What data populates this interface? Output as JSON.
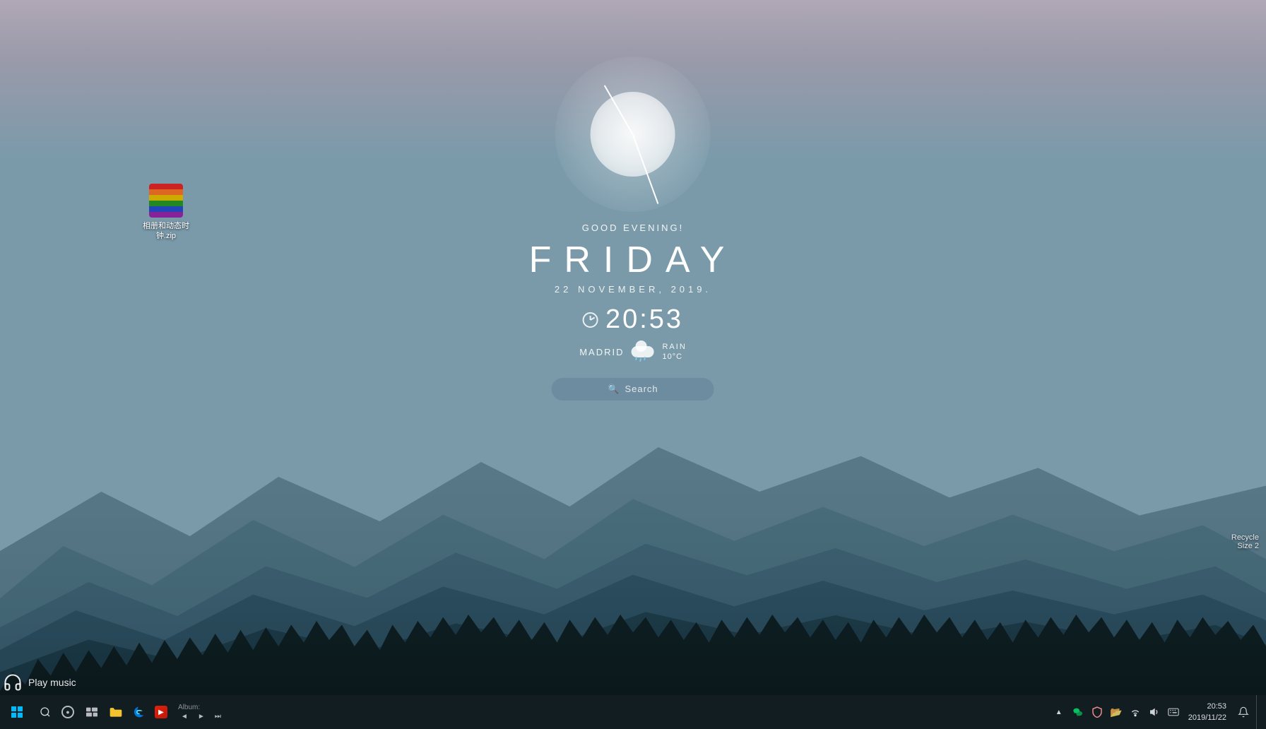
{
  "wallpaper": {
    "description": "Mountain layers wallpaper with teal/blue tones"
  },
  "clock": {
    "greeting": "GOOD EVENING!",
    "day": "FRIDAY",
    "date": "22  NOVEMBER,  2019.",
    "time": "20:53"
  },
  "weather": {
    "city": "MADRID",
    "condition": "RAIN",
    "temp": "10°C"
  },
  "search": {
    "placeholder": "Search"
  },
  "desktop_icons": [
    {
      "id": "zip-file",
      "label": "相册和动态时\n钟.zip",
      "type": "winrar-zip"
    }
  ],
  "taskbar": {
    "music": {
      "play_label": "Play music",
      "album_label": "Album:",
      "controls": {
        "prev": "◄",
        "play": "►",
        "next": "►|"
      }
    },
    "pinned": [
      {
        "name": "explorer",
        "icon": "📁"
      },
      {
        "name": "edge",
        "icon": "🌐"
      },
      {
        "name": "media",
        "icon": "🎵"
      }
    ],
    "tray": {
      "show_hidden": "^",
      "wechat": "💬",
      "antivirus": "🛡",
      "folder": "📂",
      "wifi": "📶",
      "volume": "🔊",
      "keyboard": "⌨",
      "notification": "🔔",
      "time": "20:53",
      "date": "2019/11/22"
    },
    "recycle_bin": {
      "label": "Recycle",
      "sublabel": "Size 2"
    }
  }
}
